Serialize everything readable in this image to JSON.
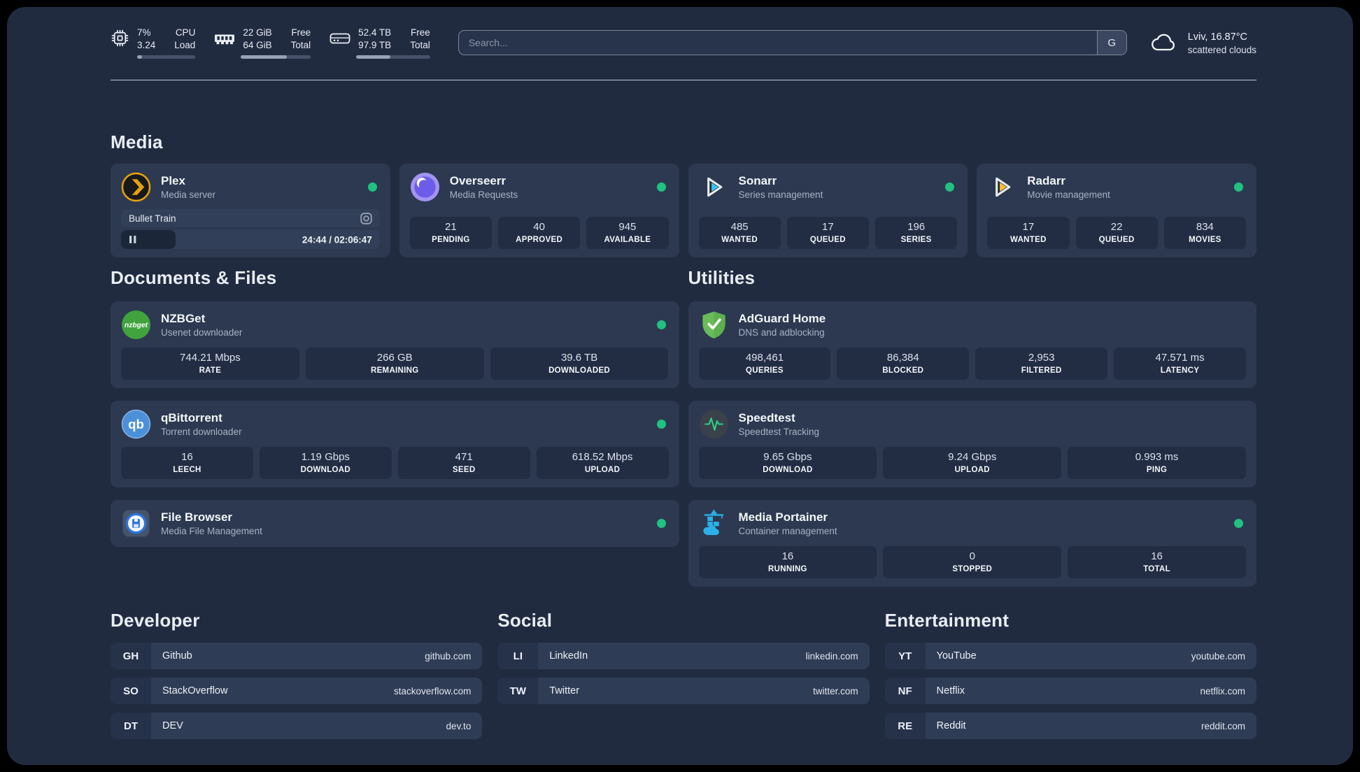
{
  "colors": {
    "background": "#212b40",
    "card": "#2c3950",
    "status_green": "#21c181",
    "plex_orange": "#e5a00d"
  },
  "system_bar": {
    "cpu": {
      "values": [
        "7%",
        "3.24"
      ],
      "labels": [
        "CPU",
        "Load"
      ],
      "progress_pct": 8
    },
    "memory": {
      "values": [
        "22 GiB",
        "64 GiB"
      ],
      "labels": [
        "Free",
        "Total"
      ],
      "progress_pct": 66
    },
    "disk": {
      "values": [
        "52.4 TB",
        "97.9 TB"
      ],
      "labels": [
        "Free",
        "Total"
      ],
      "progress_pct": 46
    }
  },
  "search": {
    "placeholder": "Search...",
    "button_label": "G"
  },
  "weather": {
    "location_temp": "Lviv, 16.87°C",
    "condition": "scattered clouds"
  },
  "media_section": {
    "title": "Media",
    "plex": {
      "name": "Plex",
      "desc": "Media server",
      "now_playing": {
        "title": "Bullet Train",
        "time": "24:44 / 02:06:47",
        "progress_pct": 21
      }
    },
    "overseerr": {
      "name": "Overseerr",
      "desc": "Media Requests",
      "stats": [
        {
          "value": "21",
          "label": "PENDING"
        },
        {
          "value": "40",
          "label": "APPROVED"
        },
        {
          "value": "945",
          "label": "AVAILABLE"
        }
      ]
    },
    "sonarr": {
      "name": "Sonarr",
      "desc": "Series management",
      "stats": [
        {
          "value": "485",
          "label": "WANTED"
        },
        {
          "value": "17",
          "label": "QUEUED"
        },
        {
          "value": "196",
          "label": "SERIES"
        }
      ]
    },
    "radarr": {
      "name": "Radarr",
      "desc": "Movie management",
      "stats": [
        {
          "value": "17",
          "label": "WANTED"
        },
        {
          "value": "22",
          "label": "QUEUED"
        },
        {
          "value": "834",
          "label": "MOVIES"
        }
      ]
    }
  },
  "documents_section": {
    "title": "Documents & Files",
    "nzbget": {
      "name": "NZBGet",
      "desc": "Usenet downloader",
      "stats": [
        {
          "value": "744.21 Mbps",
          "label": "RATE"
        },
        {
          "value": "266 GB",
          "label": "REMAINING"
        },
        {
          "value": "39.6 TB",
          "label": "DOWNLOADED"
        }
      ]
    },
    "qbittorrent": {
      "name": "qBittorrent",
      "desc": "Torrent downloader",
      "stats": [
        {
          "value": "16",
          "label": "LEECH"
        },
        {
          "value": "1.19 Gbps",
          "label": "DOWNLOAD"
        },
        {
          "value": "471",
          "label": "SEED"
        },
        {
          "value": "618.52 Mbps",
          "label": "UPLOAD"
        }
      ]
    },
    "filebrowser": {
      "name": "File Browser",
      "desc": "Media File Management"
    }
  },
  "utilities_section": {
    "title": "Utilities",
    "adguard": {
      "name": "AdGuard Home",
      "desc": "DNS and adblocking",
      "stats": [
        {
          "value": "498,461",
          "label": "QUERIES"
        },
        {
          "value": "86,384",
          "label": "BLOCKED"
        },
        {
          "value": "2,953",
          "label": "FILTERED"
        },
        {
          "value": "47.571 ms",
          "label": "LATENCY"
        }
      ]
    },
    "speedtest": {
      "name": "Speedtest",
      "desc": "Speedtest Tracking",
      "stats": [
        {
          "value": "9.65 Gbps",
          "label": "DOWNLOAD"
        },
        {
          "value": "9.24 Gbps",
          "label": "UPLOAD"
        },
        {
          "value": "0.993 ms",
          "label": "PING"
        }
      ]
    },
    "portainer": {
      "name": "Media Portainer",
      "desc": "Container management",
      "stats": [
        {
          "value": "16",
          "label": "RUNNING"
        },
        {
          "value": "0",
          "label": "STOPPED"
        },
        {
          "value": "16",
          "label": "TOTAL"
        }
      ]
    }
  },
  "developer_section": {
    "title": "Developer",
    "links": [
      {
        "tag": "GH",
        "name": "Github",
        "url": "github.com"
      },
      {
        "tag": "SO",
        "name": "StackOverflow",
        "url": "stackoverflow.com"
      },
      {
        "tag": "DT",
        "name": "DEV",
        "url": "dev.to"
      }
    ]
  },
  "social_section": {
    "title": "Social",
    "links": [
      {
        "tag": "LI",
        "name": "LinkedIn",
        "url": "linkedin.com"
      },
      {
        "tag": "TW",
        "name": "Twitter",
        "url": "twitter.com"
      }
    ]
  },
  "entertainment_section": {
    "title": "Entertainment",
    "links": [
      {
        "tag": "YT",
        "name": "YouTube",
        "url": "youtube.com"
      },
      {
        "tag": "NF",
        "name": "Netflix",
        "url": "netflix.com"
      },
      {
        "tag": "RE",
        "name": "Reddit",
        "url": "reddit.com"
      }
    ]
  }
}
